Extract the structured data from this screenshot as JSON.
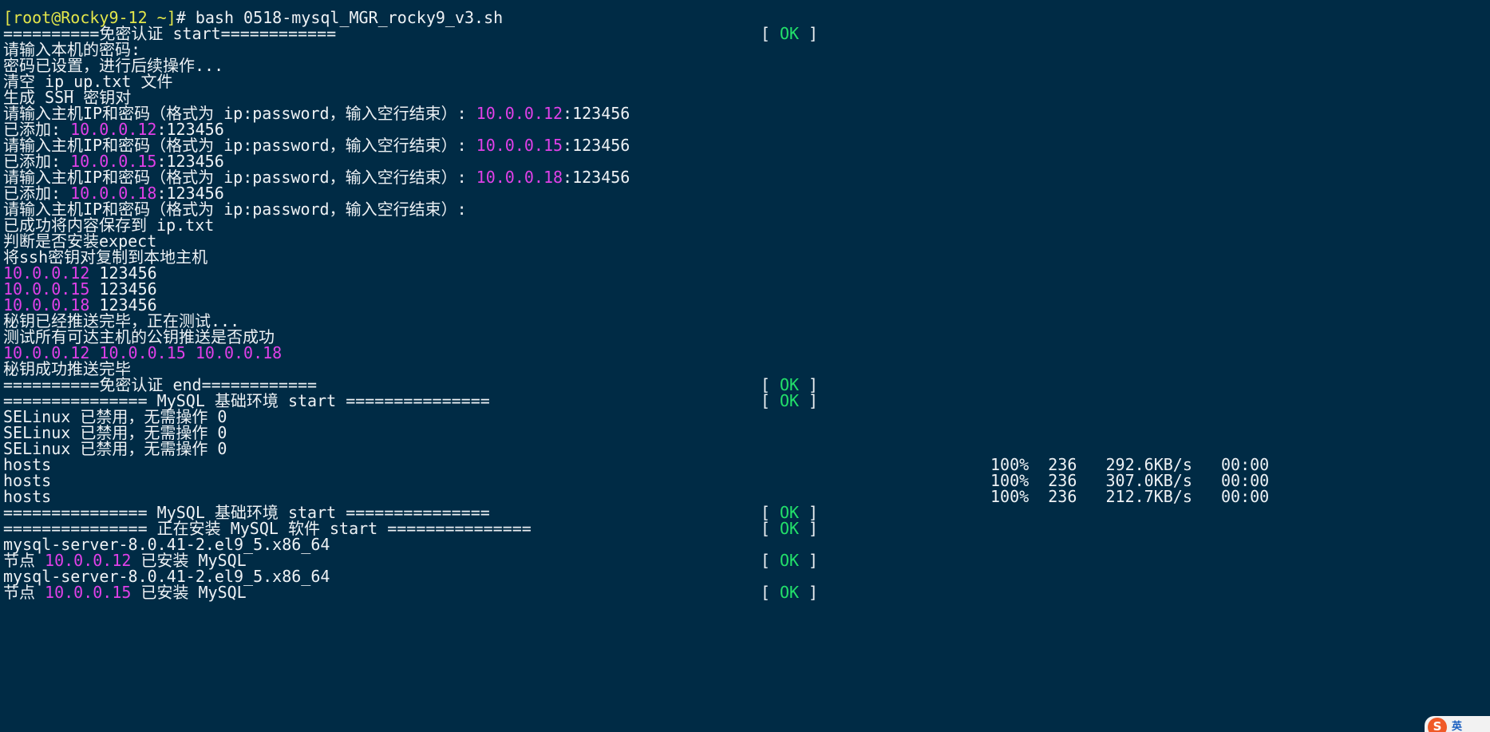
{
  "colors": {
    "background": "#002b45",
    "text": "#eef2f5",
    "ip_highlight": "#e040e8",
    "ok_green": "#22e06a",
    "prompt_yellow": "#e3e64a"
  },
  "prompt": {
    "open": "[",
    "user_host": "root@Rocky9-12",
    "path": " ~",
    "close": "]",
    "command": "# bash 0518-mysql_MGR_rocky9_v3.sh"
  },
  "lines": {
    "l02": "==========免密认证 start============",
    "l03": "请输入本机的密码:",
    "l04": "密码已设置，进行后续操作...",
    "l05": "清空 ip_up.txt 文件",
    "l06": "生成 SSH 密钥对",
    "ask_prefix": "请输入主机IP和密码（格式为 ip:password，输入空行结束）: ",
    "added_prefix": "已添加: ",
    "pw_suffix": ":123456",
    "ip1": "10.0.0.12",
    "ip2": "10.0.0.15",
    "ip3": "10.0.0.18",
    "l14": "已成功将内容保存到 ip.txt",
    "l15": "判断是否安装expect",
    "l16": "将ssh密钥对复制到本地主机",
    "pw": " 123456",
    "l20": "秘钥已经推送完毕，正在测试...",
    "l21": "测试所有可达主机的公钥推送是否成功",
    "l22_ips": "10.0.0.12 10.0.0.15 10.0.0.18",
    "l23": "秘钥成功推送完毕",
    "l24": "==========免密认证 end============",
    "l25": "=============== MySQL 基础环境 start ===============",
    "selinux": "SELinux 已禁用，无需操作 0",
    "hosts": "hosts",
    "l32": "=============== MySQL 基础环境 start ===============",
    "l33": "=============== 正在安装 MySQL 软件 start ===============",
    "pkg": "mysql-server-8.0.41-2.el9_5.x86_64",
    "node_prefix": "节点 ",
    "node_suffix": " 已安装 MySQL"
  },
  "status": {
    "open": "[",
    "ok": "OK",
    "close": "]"
  },
  "transfers": [
    {
      "pct": "100%",
      "size": "236",
      "rate": "292.6KB/s",
      "time": "00:00"
    },
    {
      "pct": "100%",
      "size": "236",
      "rate": "307.0KB/s",
      "time": "00:00"
    },
    {
      "pct": "100%",
      "size": "236",
      "rate": "212.7KB/s",
      "time": "00:00"
    }
  ],
  "ime": {
    "logo": "S",
    "label": "英"
  }
}
